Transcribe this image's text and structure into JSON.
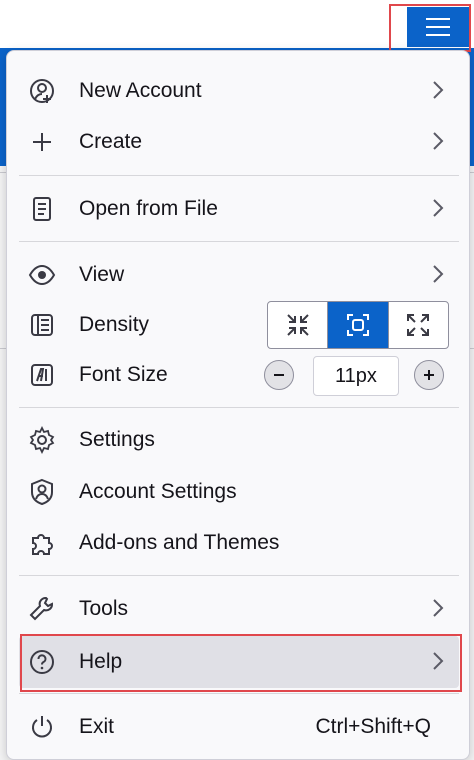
{
  "menu": {
    "new_account": "New Account",
    "create": "Create",
    "open_from_file": "Open from File",
    "view": "View",
    "density": "Density",
    "font_size": "Font Size",
    "font_size_value": "11px",
    "settings": "Settings",
    "account_settings": "Account Settings",
    "addons": "Add-ons and Themes",
    "tools": "Tools",
    "help": "Help",
    "exit": "Exit",
    "exit_shortcut": "Ctrl+Shift+Q"
  },
  "density_options": [
    "compact",
    "normal",
    "relaxed"
  ],
  "density_selected": "normal",
  "colors": {
    "accent": "#0b63c9",
    "highlight_box": "#e0474c",
    "menu_bg": "#f9f9fb",
    "hover_bg": "#e0e0e6"
  },
  "icons": {
    "hamburger": "hamburger-menu-icon",
    "new_account": "account-plus-icon",
    "create": "plus-icon",
    "open_from_file": "file-icon",
    "view": "eye-icon",
    "density": "density-icon",
    "font_size": "font-size-icon",
    "settings": "gear-icon",
    "account_settings": "account-icon",
    "addons": "puzzle-icon",
    "tools": "wrench-icon",
    "help": "help-icon",
    "exit": "power-icon"
  }
}
